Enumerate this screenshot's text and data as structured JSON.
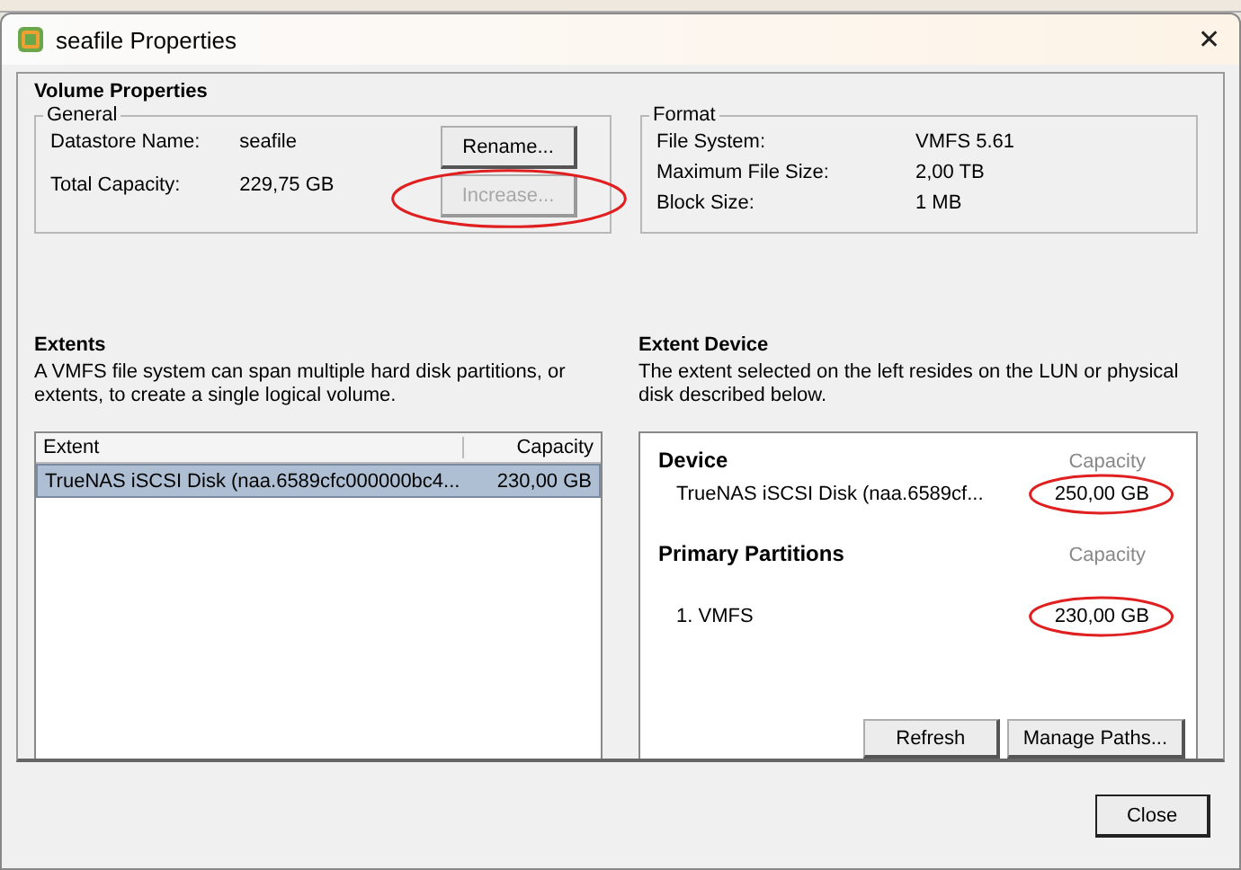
{
  "window": {
    "title": "seafile Properties",
    "close": "✕"
  },
  "volume_properties": {
    "heading": "Volume Properties",
    "general": {
      "legend": "General",
      "fields": [
        {
          "label": "Datastore Name:",
          "value": "seafile"
        },
        {
          "label": "Total Capacity:",
          "value": "229,75 GB"
        }
      ],
      "buttons": [
        {
          "label": "Rename...",
          "disabled": false,
          "highlighted": false
        },
        {
          "label": "Increase...",
          "disabled": true,
          "highlighted": true
        }
      ]
    },
    "format": {
      "legend": "Format",
      "fields": [
        {
          "label": "File System:",
          "value": "VMFS 5.61"
        },
        {
          "label": "Maximum File Size:",
          "value": "2,00 TB"
        },
        {
          "label": "Block Size:",
          "value": "1 MB"
        }
      ]
    }
  },
  "extents": {
    "heading": "Extents",
    "description": "A VMFS file system can span multiple hard disk partitions, or extents, to create a single logical volume.",
    "table": {
      "columns": [
        "Extent",
        "Capacity"
      ],
      "rows": [
        {
          "cells": [
            "TrueNAS iSCSI Disk (naa.6589cfc000000bc4...",
            "230,00 GB"
          ],
          "selected": true
        }
      ]
    }
  },
  "extent_device": {
    "heading": "Extent Device",
    "description": "The extent selected on the left resides on the LUN or physical disk described below.",
    "sections": [
      {
        "title": "Device",
        "capacity_label": "Capacity",
        "items": [
          {
            "name": "TrueNAS iSCSI Disk (naa.6589cf...",
            "capacity": "250,00 GB",
            "highlighted": true
          }
        ]
      },
      {
        "title": "Primary Partitions",
        "capacity_label": "Capacity",
        "items": [
          {
            "name": "1. VMFS",
            "capacity": "230,00 GB",
            "highlighted": true
          }
        ]
      }
    ],
    "buttons": [
      "Refresh",
      "Manage Paths..."
    ]
  },
  "footer_buttons": [
    "Close"
  ]
}
